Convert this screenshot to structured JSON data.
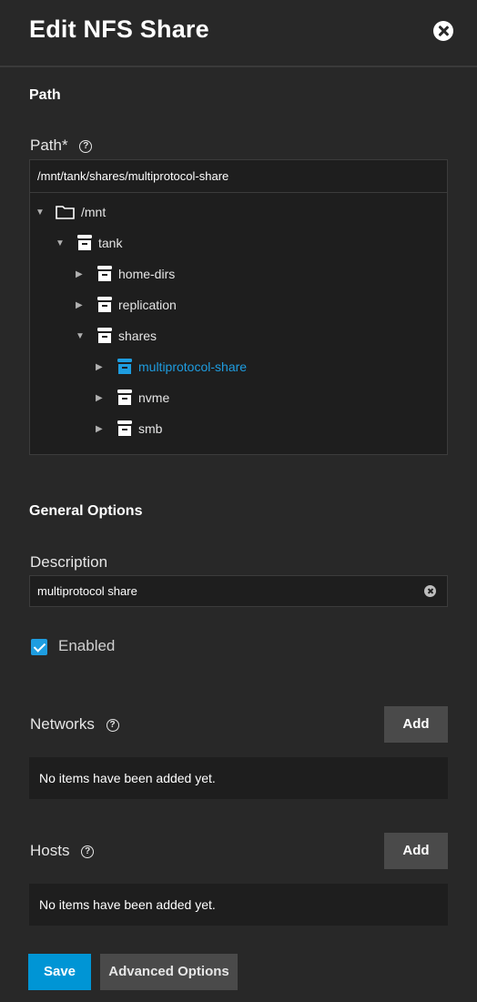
{
  "header": {
    "title": "Edit NFS Share",
    "close_icon": "close-icon"
  },
  "path_section": {
    "title": "Path",
    "label": "Path",
    "required_mark": "*",
    "value": "/mnt/tank/shares/multiprotocol-share"
  },
  "tree": [
    {
      "label": "/mnt",
      "icon": "folder-icon",
      "expanded": true,
      "selected": false
    },
    {
      "label": "tank",
      "icon": "dataset-icon",
      "expanded": true,
      "selected": false
    },
    {
      "label": "home-dirs",
      "icon": "dataset-icon",
      "expanded": false,
      "selected": false
    },
    {
      "label": "replication",
      "icon": "dataset-icon",
      "expanded": false,
      "selected": false
    },
    {
      "label": "shares",
      "icon": "dataset-icon",
      "expanded": true,
      "selected": false
    },
    {
      "label": "multiprotocol-share",
      "icon": "dataset-icon",
      "expanded": false,
      "selected": true
    },
    {
      "label": "nvme",
      "icon": "dataset-icon",
      "expanded": false,
      "selected": false
    },
    {
      "label": "smb",
      "icon": "dataset-icon",
      "expanded": false,
      "selected": false
    }
  ],
  "general": {
    "title": "General Options",
    "description_label": "Description",
    "description_value": "multiprotocol share",
    "enabled_label": "Enabled",
    "enabled": true
  },
  "networks": {
    "label": "Networks",
    "add_label": "Add",
    "empty_text": "No items have been added yet."
  },
  "hosts": {
    "label": "Hosts",
    "add_label": "Add",
    "empty_text": "No items have been added yet."
  },
  "actions": {
    "save_label": "Save",
    "advanced_label": "Advanced Options"
  },
  "colors": {
    "accent": "#0095d5",
    "selected_text": "#1e9de0",
    "background": "#282828"
  }
}
